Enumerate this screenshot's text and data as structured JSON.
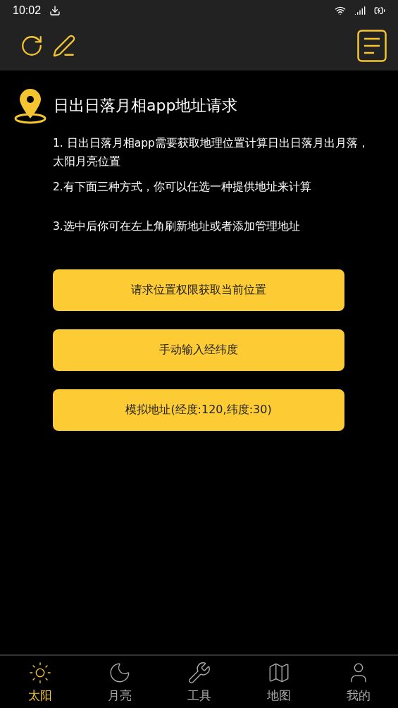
{
  "status_bar": {
    "time": "10:02"
  },
  "title": "日出日落月相app地址请求",
  "paragraphs": [
    "1. 日出日落月相app需要获取地理位置计算日出日落月出月落，太阳月亮位置",
    "2.有下面三种方式，你可以任选一种提供地址来计算",
    "3.选中后你可在左上角刷新地址或者添加管理地址"
  ],
  "buttons": [
    "请求位置权限获取当前位置",
    "手动输入经纬度",
    "模拟地址(经度:120,纬度:30)"
  ],
  "tabs": [
    {
      "label": "太阳",
      "kind": "sun",
      "selected": true
    },
    {
      "label": "月亮",
      "kind": "moon",
      "selected": false
    },
    {
      "label": "工具",
      "kind": "tools",
      "selected": false
    },
    {
      "label": "地图",
      "kind": "map",
      "selected": false
    },
    {
      "label": "我的",
      "kind": "user",
      "selected": false
    }
  ]
}
